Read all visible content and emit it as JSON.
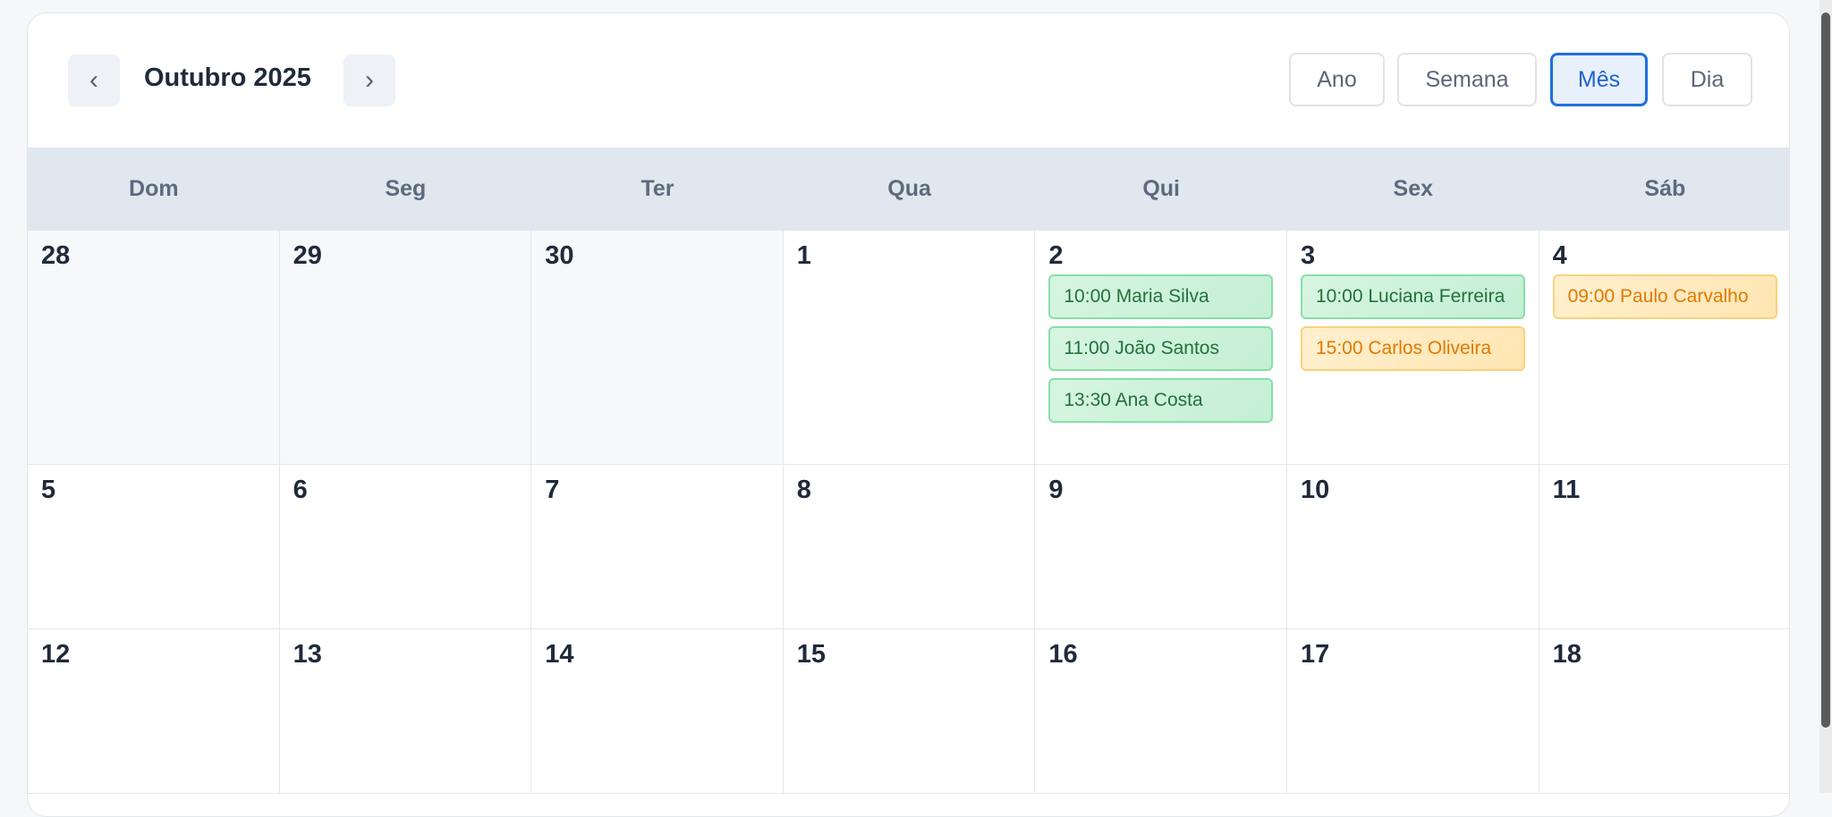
{
  "header": {
    "prev_icon": "‹",
    "next_icon": "›",
    "title": "Outubro 2025",
    "views": [
      {
        "label": "Ano",
        "active": false
      },
      {
        "label": "Semana",
        "active": false
      },
      {
        "label": "Mês",
        "active": true
      },
      {
        "label": "Dia",
        "active": false
      }
    ]
  },
  "weekdays": [
    "Dom",
    "Seg",
    "Ter",
    "Qua",
    "Qui",
    "Sex",
    "Sáb"
  ],
  "weeks": [
    [
      {
        "day": "28",
        "other_month": true,
        "events": []
      },
      {
        "day": "29",
        "other_month": true,
        "events": []
      },
      {
        "day": "30",
        "other_month": true,
        "events": []
      },
      {
        "day": "1",
        "other_month": false,
        "events": []
      },
      {
        "day": "2",
        "other_month": false,
        "events": [
          {
            "label": "10:00 Maria Silva",
            "color": "green"
          },
          {
            "label": "11:00 João Santos",
            "color": "green"
          },
          {
            "label": "13:30 Ana Costa",
            "color": "green"
          }
        ]
      },
      {
        "day": "3",
        "other_month": false,
        "events": [
          {
            "label": "10:00 Luciana Ferreira",
            "color": "green"
          },
          {
            "label": "15:00 Carlos Oliveira",
            "color": "orange"
          }
        ]
      },
      {
        "day": "4",
        "other_month": false,
        "events": [
          {
            "label": "09:00 Paulo Carvalho",
            "color": "orange"
          }
        ]
      }
    ],
    [
      {
        "day": "5",
        "other_month": false,
        "events": []
      },
      {
        "day": "6",
        "other_month": false,
        "events": []
      },
      {
        "day": "7",
        "other_month": false,
        "events": []
      },
      {
        "day": "8",
        "other_month": false,
        "events": []
      },
      {
        "day": "9",
        "other_month": false,
        "events": []
      },
      {
        "day": "10",
        "other_month": false,
        "events": []
      },
      {
        "day": "11",
        "other_month": false,
        "events": []
      }
    ],
    [
      {
        "day": "12",
        "other_month": false,
        "events": []
      },
      {
        "day": "13",
        "other_month": false,
        "events": []
      },
      {
        "day": "14",
        "other_month": false,
        "events": []
      },
      {
        "day": "15",
        "other_month": false,
        "events": []
      },
      {
        "day": "16",
        "other_month": false,
        "events": []
      },
      {
        "day": "17",
        "other_month": false,
        "events": []
      },
      {
        "day": "18",
        "other_month": false,
        "events": []
      }
    ]
  ],
  "colors": {
    "accent": "#1d6fe0",
    "confirmed": "#23703c",
    "pending": "#e07a00"
  }
}
